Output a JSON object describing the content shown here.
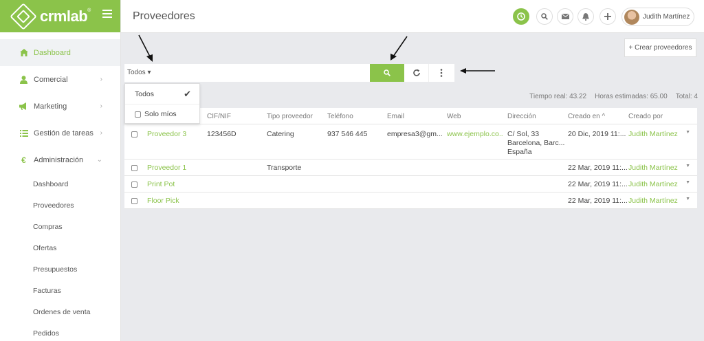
{
  "brand": {
    "name": "crmlab",
    "reg": "®"
  },
  "sidebar": {
    "items": [
      {
        "label": "Dashboard",
        "icon": "home-icon",
        "active": true
      },
      {
        "label": "Comercial",
        "icon": "user-icon",
        "chevron": "›"
      },
      {
        "label": "Marketing",
        "icon": "megaphone-icon",
        "chevron": "›"
      },
      {
        "label": "Gestión de tareas",
        "icon": "list-icon",
        "chevron": "›"
      },
      {
        "label": "Administración",
        "icon": "euro-icon",
        "chevron": "⌄"
      }
    ],
    "subitems": [
      "Dashboard",
      "Proveedores",
      "Compras",
      "Ofertas",
      "Presupuestos",
      "Facturas",
      "Ordenes de venta",
      "Pedidos"
    ]
  },
  "header": {
    "title": "Proveedores",
    "user_name": "Judith Martínez"
  },
  "toolbar": {
    "create_label": "+ Crear proveedores",
    "filter_label": "Todos ▾",
    "search_placeholder": ""
  },
  "dropdown": {
    "options": [
      {
        "label": "Todos",
        "checked": true
      },
      {
        "label": "Solo míos",
        "checked": false
      }
    ]
  },
  "stats": {
    "tiempo_real": "Tiempo real: 43.22",
    "horas_estimadas": "Horas estimadas: 65.00",
    "total": "Total: 4"
  },
  "table": {
    "columns": [
      "CIF/NIF",
      "Tipo proveedor",
      "Teléfono",
      "Email",
      "Web",
      "Dirección",
      "Creado en",
      "Creado por"
    ],
    "rows": [
      {
        "name": "Proveedor 3",
        "cif": "123456D",
        "tipo": "Catering",
        "telefono": "937 546 445",
        "email": "empresa3@gm...",
        "web": "www.ejemplo.co...",
        "direccion": [
          "C/ Sol, 33",
          "Barcelona, Barc...",
          "España"
        ],
        "creado_en": "20 Dic, 2019 11:...",
        "creado_por": "Judith Martínez"
      },
      {
        "name": "Proveedor 1",
        "cif": "",
        "tipo": "Transporte",
        "telefono": "",
        "email": "",
        "web": "",
        "direccion": [],
        "creado_en": "22 Mar, 2019 11:...",
        "creado_por": "Judith Martínez"
      },
      {
        "name": "Print Pot",
        "cif": "",
        "tipo": "",
        "telefono": "",
        "email": "",
        "web": "",
        "direccion": [],
        "creado_en": "22 Mar, 2019 11:...",
        "creado_por": "Judith Martínez"
      },
      {
        "name": "Floor Pick",
        "cif": "",
        "tipo": "",
        "telefono": "",
        "email": "",
        "web": "",
        "direccion": [],
        "creado_en": "22 Mar, 2019 11:...",
        "creado_por": "Judith Martínez"
      }
    ]
  },
  "colors": {
    "accent": "#8bc34a",
    "background": "#e9eaed"
  }
}
